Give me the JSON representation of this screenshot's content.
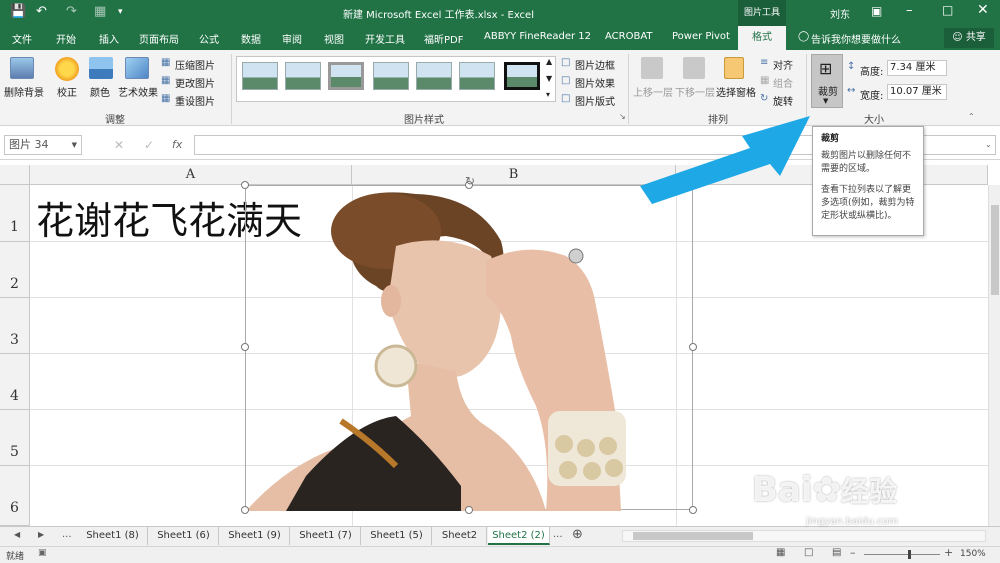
{
  "window": {
    "title": "新建 Microsoft Excel 工作表.xlsx  -  Excel",
    "tools_label": "图片工具",
    "user": "刘东"
  },
  "tabs": [
    "文件",
    "开始",
    "插入",
    "页面布局",
    "公式",
    "数据",
    "审阅",
    "视图",
    "开发工具",
    "福昕PDF",
    "ABBYY FineReader 12",
    "ACROBAT",
    "Power Pivot",
    "格式"
  ],
  "tellme": "告诉我你想要做什么",
  "share": "共享",
  "ribbon": {
    "adjust": {
      "remove_bg": "删除背景",
      "correct": "校正",
      "color": "颜色",
      "art": "艺术效果",
      "compress": "压缩图片",
      "change": "更改图片",
      "reset": "重设图片",
      "label": "调整"
    },
    "styles": {
      "border": "图片边框",
      "effect": "图片效果",
      "layout": "图片版式",
      "label": "图片样式"
    },
    "arrange": {
      "forward": "上移一层",
      "backward": "下移一层",
      "pane": "选择窗格",
      "align": "对齐",
      "group": "组合",
      "rotate": "旋转",
      "label": "排列"
    },
    "size": {
      "crop": "裁剪",
      "height_label": "高度:",
      "height": "7.34 厘米",
      "width_label": "宽度:",
      "width": "10.07 厘米",
      "label": "大小"
    }
  },
  "namebox": "图片 34",
  "fx": "fx",
  "columns": [
    "A",
    "B"
  ],
  "rows": [
    "1",
    "2",
    "3",
    "4",
    "5",
    "6"
  ],
  "cell_a1": "花谢花飞花满天",
  "tooltip": {
    "title": "裁剪",
    "line1": "裁剪图片以删除任何不需要的区域。",
    "line2": "查看下拉列表以了解更多选项(例如，裁剪为特定形状或纵横比)。"
  },
  "sheets": [
    "Sheet1 (8)",
    "Sheet1 (6)",
    "Sheet1 (9)",
    "Sheet1 (7)",
    "Sheet1 (5)",
    "Sheet2",
    "Sheet2 (2)"
  ],
  "sheet_more": "...",
  "status": {
    "ready": "就绪",
    "zoom": "150%"
  },
  "watermark": {
    "brand": "Bai",
    "brand2": "经验",
    "url": "jingyan.baidu.com"
  },
  "colors": {
    "excel_green": "#217346",
    "arrow": "#1ea8e6"
  }
}
